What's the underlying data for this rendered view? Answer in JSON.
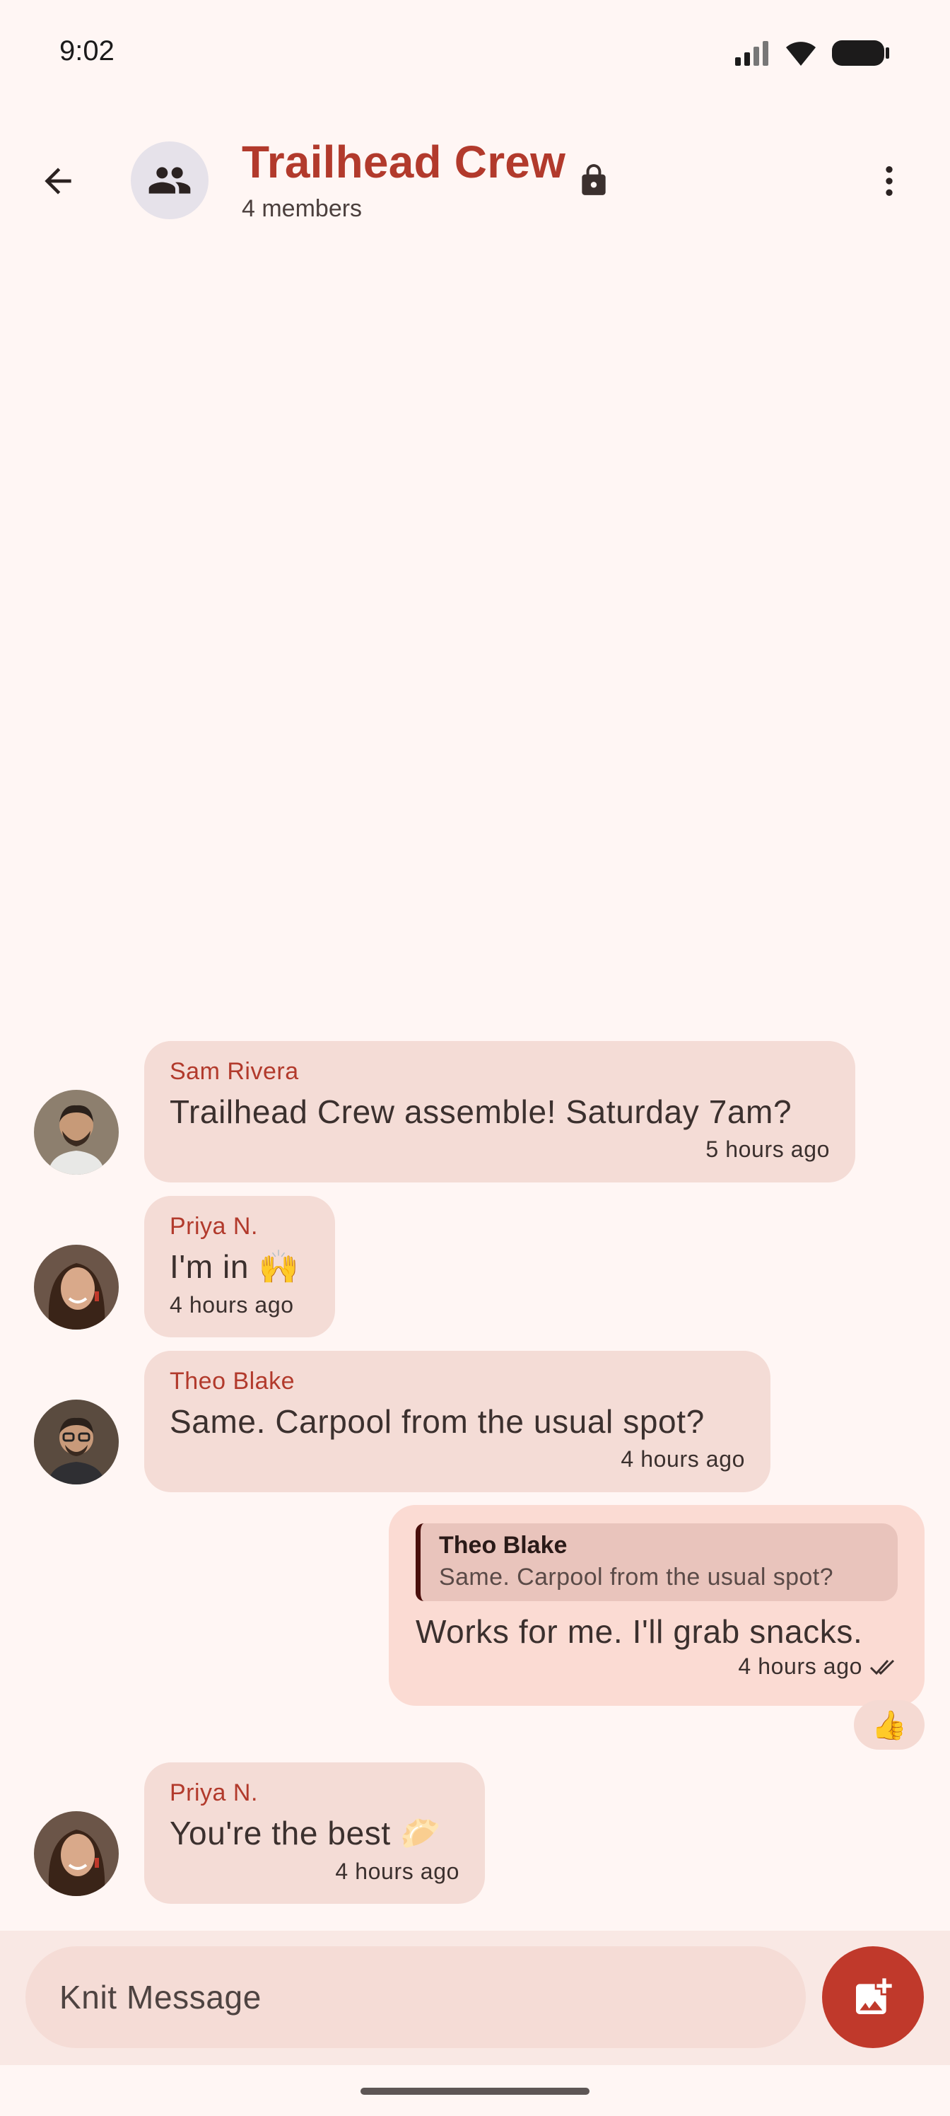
{
  "status_bar": {
    "time": "9:02"
  },
  "header": {
    "title": "Trailhead Crew",
    "subtitle": "4 members"
  },
  "messages": [
    {
      "sender": "Sam Rivera",
      "text": "Trailhead Crew assemble! Saturday 7am?",
      "time": "5 hours ago",
      "avatar": "sam-avatar"
    },
    {
      "sender": "Priya N.",
      "text": "I'm in 🙌",
      "time": "4 hours ago",
      "avatar": "priya-avatar"
    },
    {
      "sender": "Theo Blake",
      "text": "Same. Carpool from the usual spot?",
      "time": "4 hours ago",
      "avatar": "theo-avatar"
    },
    {
      "mine": true,
      "reply_to": {
        "name": "Theo Blake",
        "text": "Same. Carpool from the usual spot?"
      },
      "text": "Works for me. I'll grab snacks.",
      "time": "4 hours ago",
      "status": "read",
      "reaction": "👍"
    },
    {
      "sender": "Priya N.",
      "text": "You're the best 🥟",
      "time": "4 hours ago",
      "avatar": "priya-avatar"
    }
  ],
  "composer": {
    "placeholder": "Knit Message"
  },
  "colors": {
    "accent": "#b23a2c",
    "bubble": "#f4dcd6",
    "mine_bubble": "#fbdbd3",
    "send_button": "#c0392b"
  }
}
